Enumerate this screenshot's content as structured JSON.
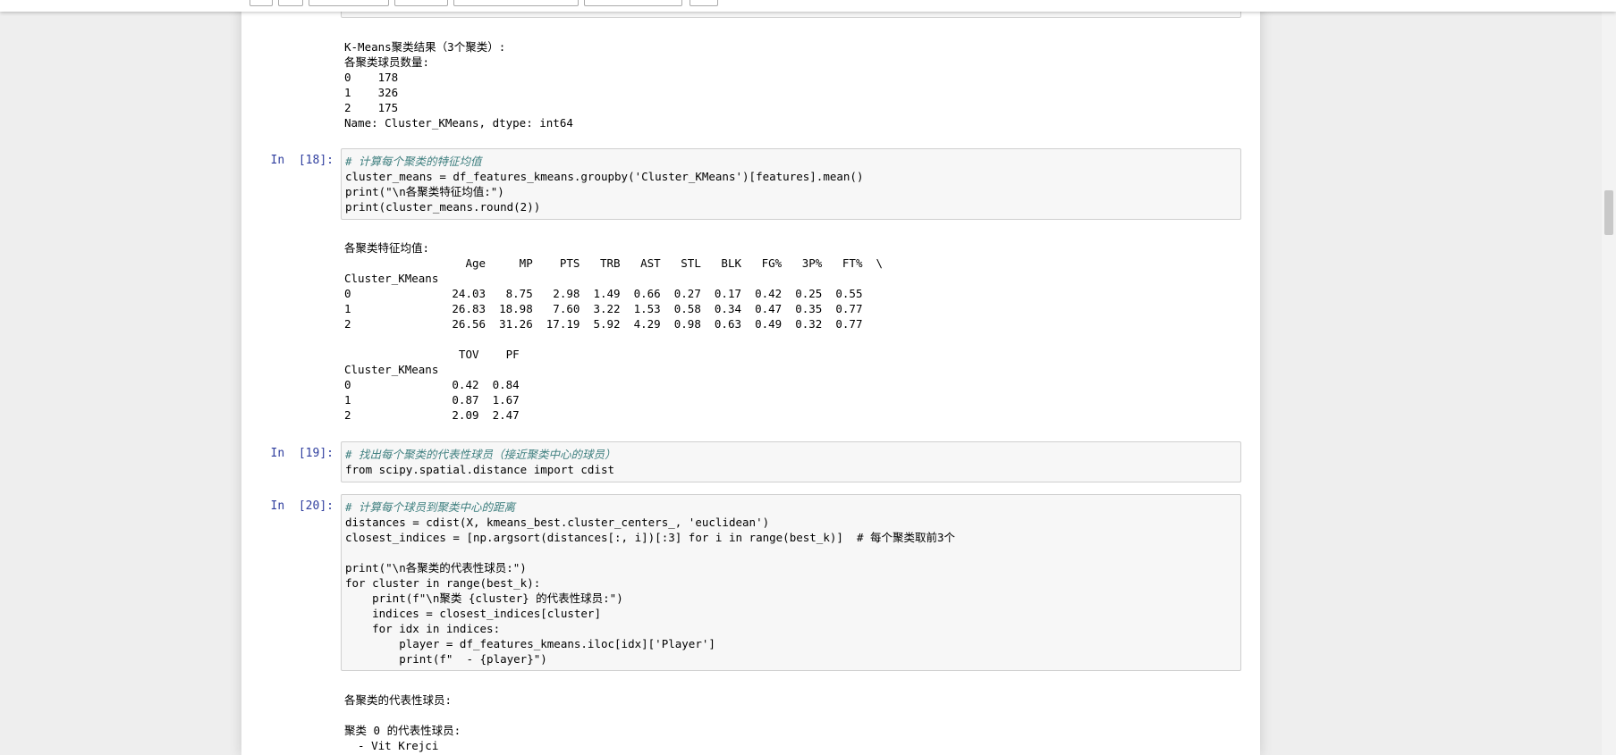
{
  "cells": {
    "c17_output": {
      "lines": [
        "K-Means聚类结果（3个聚类）:",
        "各聚类球员数量:",
        "0    178",
        "1    326",
        "2    175",
        "Name: Cluster_KMeans, dtype: int64"
      ]
    },
    "c18": {
      "prompt": "In  [18]:",
      "code": [
        "# 计算每个聚类的特征均值",
        "cluster_means = df_features_kmeans.groupby('Cluster_KMeans')[features].mean()",
        "print(\"\\n各聚类特征均值:\")",
        "print(cluster_means.round(2))"
      ],
      "output": [
        "各聚类特征均值:",
        "                  Age     MP    PTS   TRB   AST   STL   BLK   FG%   3P%   FT%  \\",
        "Cluster_KMeans",
        "0               24.03   8.75   2.98  1.49  0.66  0.27  0.17  0.42  0.25  0.55",
        "1               26.83  18.98   7.60  3.22  1.53  0.58  0.34  0.47  0.35  0.77",
        "2               26.56  31.26  17.19  5.92  4.29  0.98  0.63  0.49  0.32  0.77",
        "",
        "                 TOV    PF",
        "Cluster_KMeans",
        "0               0.42  0.84",
        "1               0.87  1.67",
        "2               2.09  2.47"
      ]
    },
    "c19": {
      "prompt": "In  [19]:",
      "code": [
        "# 找出每个聚类的代表性球员（接近聚类中心的球员）",
        "from scipy.spatial.distance import cdist"
      ]
    },
    "c20": {
      "prompt": "In  [20]:",
      "code": [
        "# 计算每个球员到聚类中心的距离",
        "distances = cdist(X, kmeans_best.cluster_centers_, 'euclidean')",
        "closest_indices = [np.argsort(distances[:, i])[:3] for i in range(best_k)]  # 每个聚类取前3个",
        "",
        "print(\"\\n各聚类的代表性球员:\")",
        "for cluster in range(best_k):",
        "    print(f\"\\n聚类 {cluster} 的代表性球员:\")",
        "    indices = closest_indices[cluster]",
        "    for idx in indices:",
        "        player = df_features_kmeans.iloc[idx]['Player']",
        "        print(f\"  - {player}\")"
      ],
      "output": [
        "各聚类的代表性球员:",
        "",
        "聚类 0 的代表性球员:",
        "  - Vit Krejci"
      ]
    }
  }
}
